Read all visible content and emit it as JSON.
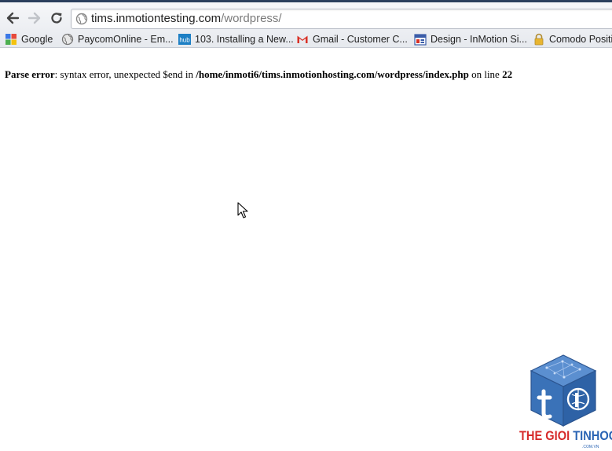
{
  "browser": {
    "url_host": "tims.inmotiontesting.com",
    "url_path": "/wordpress/"
  },
  "bookmarks": [
    {
      "label": "Google",
      "icon": "google-icon"
    },
    {
      "label": "PaycomOnline - Em...",
      "icon": "globe-icon"
    },
    {
      "label": "103. Installing a New...",
      "icon": "hub-icon"
    },
    {
      "label": "Gmail - Customer C...",
      "icon": "gmail-icon"
    },
    {
      "label": "Design - InMotion Si...",
      "icon": "calendar-icon"
    },
    {
      "label": "Comodo Positi",
      "icon": "lock-icon"
    }
  ],
  "hub_icon_text": "hub",
  "error": {
    "label": "Parse error",
    "message": ": syntax error, unexpected $end in ",
    "file": "/home/inmoti6/tims.inmotionhosting.com/wordpress/index.php",
    "on_line": " on line ",
    "line": "22"
  },
  "watermark": {
    "word1": "THE GIOI",
    "word2": " TINHOC",
    "sub": ".COM.VN"
  },
  "colors": {
    "watermark_red": "#d62a2a",
    "watermark_blue": "#2a64b4",
    "cube_blue": "#3a72b8"
  }
}
